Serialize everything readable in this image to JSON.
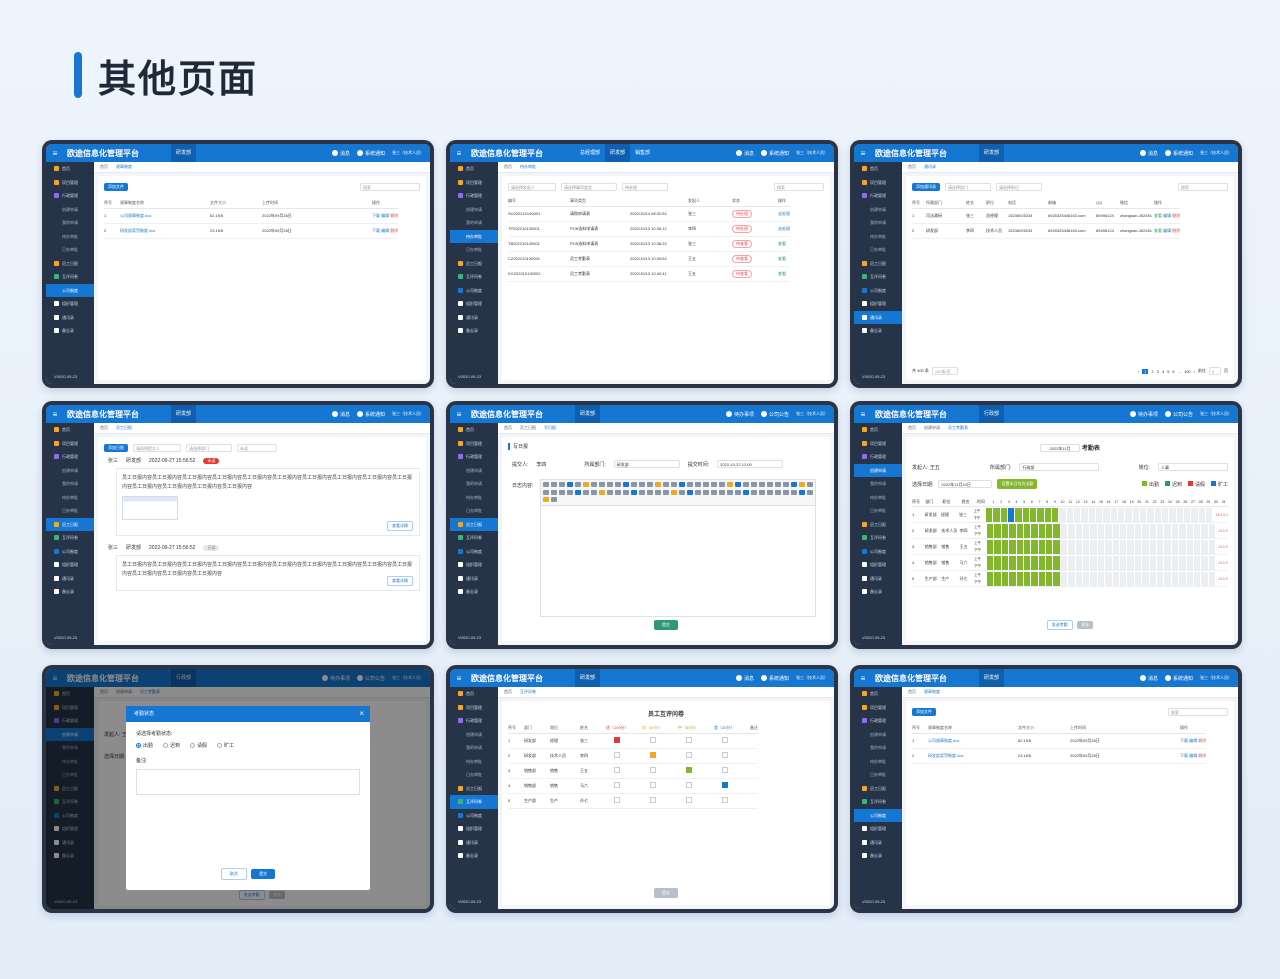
{
  "page": {
    "title": "其他页面"
  },
  "app": {
    "brand": "欧途信息化管理平台",
    "tabs": {
      "rd": "研发部",
      "gm": "总经理部",
      "sales": "销售部",
      "admin": "行政部"
    },
    "tools": {
      "msg": "消息",
      "notice": "系统通知",
      "todo": "待办事项",
      "notice2": "公司公告"
    },
    "user": "张三（技术人员）",
    "version": "V0020-09-23",
    "home": "首页",
    "sidebar": [
      {
        "label": "首页",
        "color": "#f5a623"
      },
      {
        "label": "项目管理",
        "color": "#f5a623"
      },
      {
        "label": "行政管理",
        "color": "#8e6cf0"
      },
      {
        "label": "创建申请",
        "sub": true
      },
      {
        "label": "我的申请",
        "sub": true
      },
      {
        "label": "待办审批",
        "sub": true
      },
      {
        "label": "已办审批",
        "sub": true
      },
      {
        "label": "员工日报",
        "color": "#f5a623"
      },
      {
        "label": "互评问卷",
        "color": "#3bb37a"
      },
      {
        "label": "公司制度",
        "color": "#1677d2"
      },
      {
        "label": "组织管理",
        "color": "#ffffff"
      },
      {
        "label": "通讯录",
        "color": "#ffffff"
      },
      {
        "label": "备忘录",
        "color": "#ffffff"
      }
    ]
  },
  "p1": {
    "crumb": "规章制度",
    "add": "添加文件",
    "search": "搜索",
    "headers": [
      "序号",
      "规章制度名称",
      "文件大小",
      "上传时间",
      "操作"
    ],
    "rows": [
      {
        "no": "1",
        "name": "公司规章制度.doc",
        "size": "62.1KB",
        "time": "2022年09月26日"
      },
      {
        "no": "2",
        "name": "研发部奖罚制度.doc",
        "size": "23.1KB",
        "time": "2022年09月26日"
      }
    ],
    "ops": {
      "dl": "下载",
      "edit": "编辑",
      "del": "删除"
    }
  },
  "p2": {
    "crumb": "待办审批",
    "filters": [
      "请选择发起人",
      "请选择事项类型",
      "待处理"
    ],
    "search": "搜索",
    "headers": [
      "编号",
      "事项类型",
      "",
      "发起人",
      "状态",
      "操作"
    ],
    "rows": [
      {
        "id": "SU202210140001",
        "type": "请购申请表",
        "time": "2022/10/14 08:32:52",
        "who": "张三",
        "st": "待处理",
        "op": "去处理"
      },
      {
        "id": "TP202210130001",
        "type": "PCB选料申请表",
        "time": "2022/10/13 10:35:12",
        "who": "李四",
        "st": "待处理",
        "op": "去处理"
      },
      {
        "id": "TB202210130001",
        "type": "PCB选料申请表",
        "time": "2022/10/13 10:38:22",
        "who": "张三",
        "st": "待查看",
        "op": "查看"
      },
      {
        "id": "CZ202210130001",
        "type": "员工考勤表",
        "time": "2022/10/13 10:39:52",
        "who": "王五",
        "st": "待查看",
        "op": "查看"
      },
      {
        "id": "KG202210130002",
        "type": "员工考勤表",
        "time": "2022/10/13 10:42:41",
        "who": "王五",
        "st": "待查看",
        "op": "查看"
      }
    ]
  },
  "p3": {
    "crumb": "通讯录",
    "add": "添加通讯录",
    "filters": [
      "请选择部门",
      "请选择职位"
    ],
    "search": "搜索",
    "headers": [
      "序号",
      "所属部门",
      "姓名",
      "职位",
      "电话",
      "邮箱",
      "QQ",
      "微信",
      "操作"
    ],
    "rows": [
      {
        "no": "1",
        "dept": "司法政研",
        "name": "张三",
        "pos": "总经理",
        "tel": "15236025234",
        "mail": "6925325448163.com",
        "qq": "89496124",
        "wx": "zhangsan-452451"
      },
      {
        "no": "2",
        "dept": "研发部",
        "name": "李四",
        "pos": "技术人员",
        "tel": "15236025234",
        "mail": "6925325448163.com",
        "qq": "89496124",
        "wx": "zhangsan-452451"
      }
    ],
    "ops": {
      "view": "查看",
      "edit": "编辑",
      "del": "删除"
    },
    "footer": {
      "total": "共 400 条",
      "size": "100条/页",
      "pages": [
        "1",
        "2",
        "3",
        "4",
        "5",
        "6",
        "...",
        "100"
      ],
      "goto": "前往",
      "page": "4",
      "unit": "页"
    }
  },
  "p4": {
    "crumb": "员工日报",
    "add": "添加日报",
    "filters": [
      "请选择提交人",
      "请选择部门",
      "未读"
    ],
    "entries": [
      {
        "name": "张三",
        "dept": "研发部",
        "time": "2022-09-27 15:56:52",
        "tag": "未读",
        "text": "员工日报内容员工日报内容员工日报内容员工日报内容员工日报内容员工日报内容员工日报内容员工日报内容员工日报内容员工日报内容员工日报内容员工日报内容员工日报内容员工日报内容",
        "btn": "查看详情"
      },
      {
        "name": "张三",
        "dept": "研发部",
        "time": "2022-09-27 15:56:52",
        "tag": "已读",
        "text": "员工日报内容员工日报内容员工日报内容员工日报内容员工日报内容员工日报内容员工日报内容员工日报内容员工日报内容员工日报内容员工日报内容员工日报内容员工日报内容",
        "btn": "查看详情"
      }
    ]
  },
  "p5": {
    "crumbs": [
      "员工日报",
      "写日报"
    ],
    "title": "写日报",
    "submitter_label": "提交人:",
    "submitter": "李四",
    "dept_label": "所属部门:",
    "dept": "研发部",
    "time_label": "提交时间:",
    "time": "2022-10-22 12:00",
    "content_label": "日志内容:",
    "submit": "提交"
  },
  "p6": {
    "crumbs": [
      "创建申请",
      "员工考勤表"
    ],
    "month": "2022年11月",
    "title": "考勤表",
    "initiator": "发起人: 王五",
    "dept_label": "所属部门:",
    "dept": "行政部",
    "pos_label": "岗位:",
    "pos": "人事",
    "date_label": "选择日期:",
    "date": "2022年11月10日",
    "set_btn": "设置本日均为出勤",
    "legend": [
      {
        "t": "出勤",
        "c": "#84b82c"
      },
      {
        "t": "迟到",
        "c": "#21a35d"
      },
      {
        "t": "请假",
        "c": "#e53935"
      },
      {
        "t": "旷工",
        "c": "#1677d2"
      }
    ],
    "headers": [
      "序号",
      "部门",
      "职位",
      "姓名",
      "时间"
    ],
    "rows": [
      {
        "no": "1",
        "dept": "研发部",
        "pos": "经理",
        "name": "张三",
        "stat": "13 0.5 1"
      },
      {
        "no": "2",
        "dept": "研发部",
        "pos": "技术人员",
        "name": "李四",
        "stat": "13 0 0"
      },
      {
        "no": "3",
        "dept": "销售部",
        "pos": "销售",
        "name": "王五",
        "stat": "13 0 0"
      },
      {
        "no": "4",
        "dept": "销售部",
        "pos": "销售",
        "name": "马六",
        "stat": "13 0 0"
      },
      {
        "no": "5",
        "dept": "生产部",
        "pos": "生产",
        "name": "孙七",
        "stat": "13 0 0"
      }
    ],
    "am": "上午",
    "pm": "下午",
    "send": "发送考勤",
    "save": "保存"
  },
  "p7": {
    "modal_title": "考勤状态",
    "prompt": "请选择考勤状态:",
    "options": [
      "出勤",
      "迟到",
      "请假",
      "旷工"
    ],
    "note": "备注:",
    "cancel": "取消",
    "ok": "提交",
    "bg_initiator": "发起人: 王",
    "bg_date": "选择日期:",
    "bg_send": "发送考勤",
    "bg_save": "保存"
  },
  "p8": {
    "crumb": "互评问卷",
    "title": "员工互评问卷",
    "headers": [
      "序号",
      "部门",
      "岗位",
      "姓名",
      "优（100分）",
      "良（80分）",
      "中（60分）",
      "差（20分）",
      "备注"
    ],
    "rows": [
      {
        "no": "1",
        "dept": "研发部",
        "pos": "经理",
        "name": "张三",
        "sel": 0
      },
      {
        "no": "2",
        "dept": "研发部",
        "pos": "技术人员",
        "name": "李四",
        "sel": 1
      },
      {
        "no": "3",
        "dept": "销售部",
        "pos": "销售",
        "name": "王五",
        "sel": 2
      },
      {
        "no": "4",
        "dept": "销售部",
        "pos": "销售",
        "name": "马六",
        "sel": 3
      },
      {
        "no": "5",
        "dept": "生产部",
        "pos": "生产",
        "name": "孙七",
        "sel": -1
      }
    ],
    "submit": "提交"
  }
}
